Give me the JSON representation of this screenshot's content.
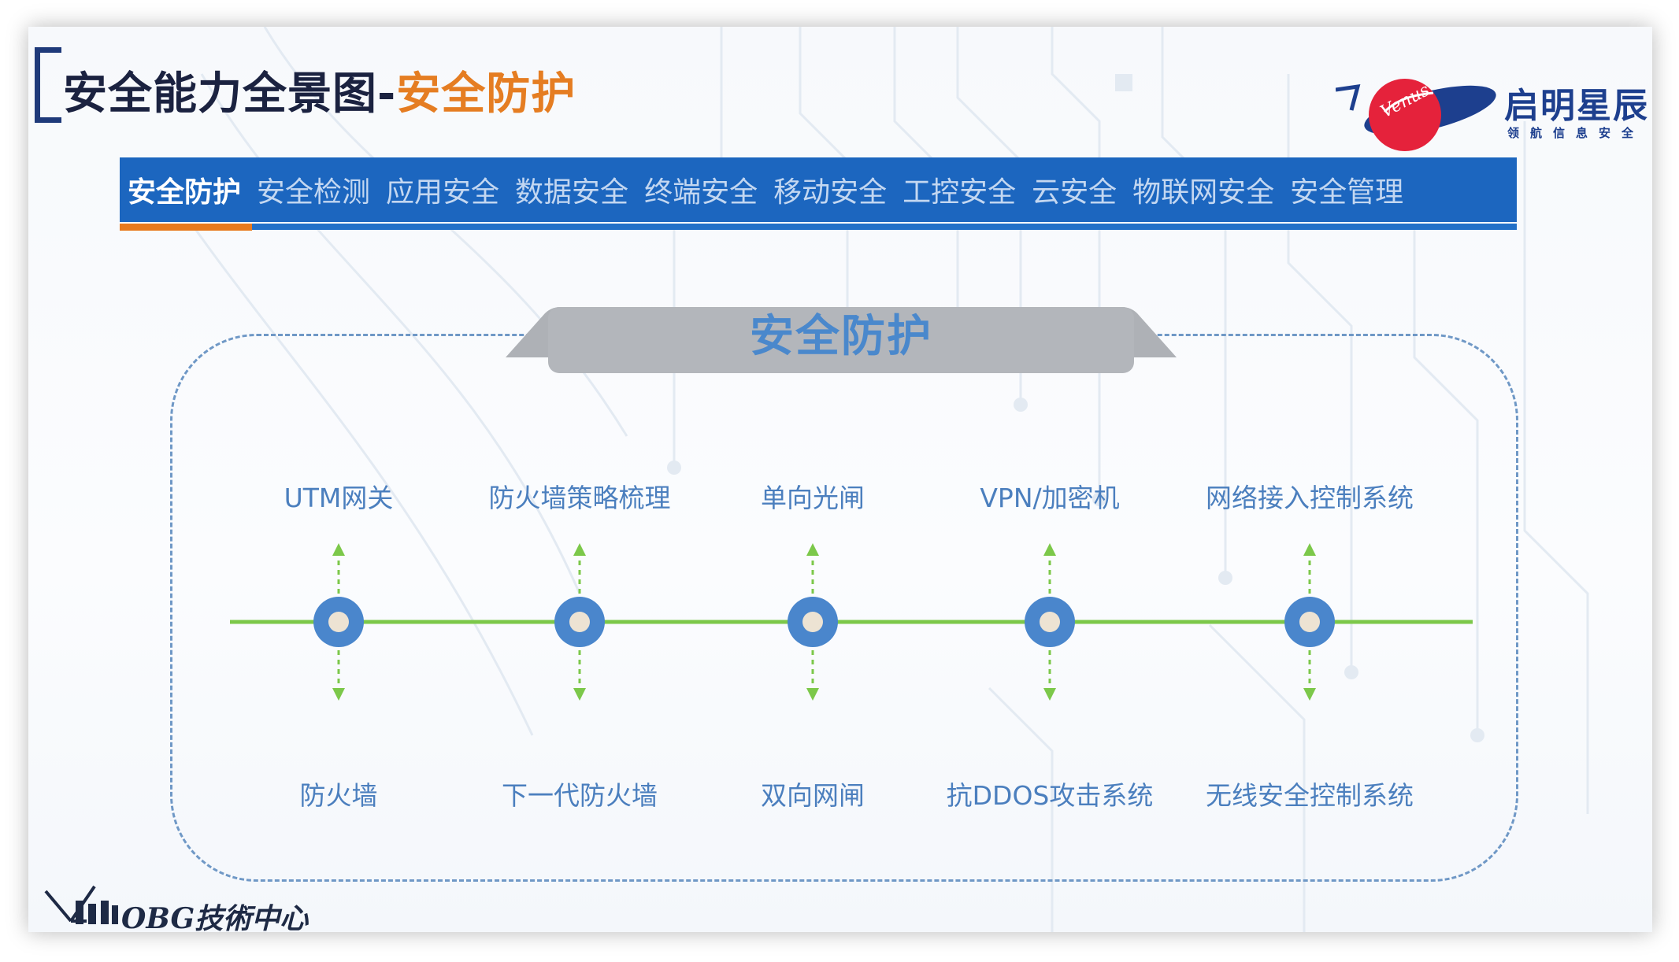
{
  "title": {
    "main": "安全能力全景图-",
    "accent": "安全防护"
  },
  "logo": {
    "brand_name": "启明星辰",
    "tagline": "领航信息安全",
    "emblem_text": "Venus"
  },
  "tabs": [
    {
      "label": "安全防护",
      "active": true
    },
    {
      "label": "安全检测",
      "active": false
    },
    {
      "label": "应用安全",
      "active": false
    },
    {
      "label": "数据安全",
      "active": false
    },
    {
      "label": "终端安全",
      "active": false
    },
    {
      "label": "移动安全",
      "active": false
    },
    {
      "label": "工控安全",
      "active": false
    },
    {
      "label": "云安全",
      "active": false
    },
    {
      "label": "物联网安全",
      "active": false
    },
    {
      "label": "安全管理",
      "active": false
    }
  ],
  "section": {
    "heading": "安全防护"
  },
  "products": [
    {
      "top": "UTM网关",
      "bottom": "防火墙"
    },
    {
      "top": "防火墙策略梳理",
      "bottom": "下一代防火墙"
    },
    {
      "top": "单向光闸",
      "bottom": "双向网闸"
    },
    {
      "top": "VPN/加密机",
      "bottom": "抗DDOS攻击系统"
    },
    {
      "top": "网络接入控制系统",
      "bottom": "无线安全控制系统"
    }
  ],
  "footer": {
    "brand": "OBG技術中心"
  },
  "colors": {
    "tab_bar": "#1c66bf",
    "tab_active_underline": "#e87a1e",
    "title_accent": "#e57d22",
    "timeline_line": "#7cc84a",
    "node_ring": "#4a86cc",
    "node_center": "#ede3d3",
    "label_text": "#4b7fbe",
    "frame_border": "#6f98c6",
    "banner_fill": "#b3b6bb"
  },
  "icons": {
    "brand_logo": "venus-star-logo",
    "footer_logo": "obg-antenna-logo"
  }
}
